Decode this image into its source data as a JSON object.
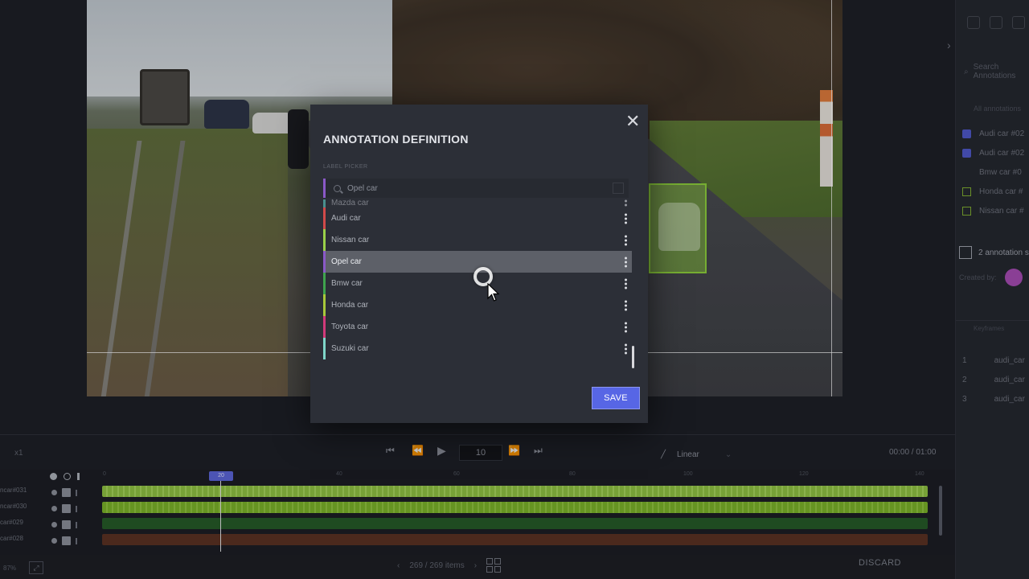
{
  "side_panel": {
    "search_placeholder": "Search Annotations",
    "heading": "All annotations",
    "items": [
      {
        "label": "Audi car #02",
        "kind": "checked"
      },
      {
        "label": "Audi car #02",
        "kind": "checked"
      },
      {
        "label": "Bmw car #0",
        "kind": "unchecked"
      },
      {
        "label": "Honda car #",
        "kind": "box"
      },
      {
        "label": "Nissan car #",
        "kind": "box"
      }
    ],
    "annotation_summary": "2 annotation s",
    "created_by": "Created by:",
    "sub_heading": "Keyframes",
    "keyframes": [
      {
        "index": "1",
        "label": "audi_car"
      },
      {
        "index": "2",
        "label": "audi_car"
      },
      {
        "index": "3",
        "label": "audi_car"
      }
    ]
  },
  "transport": {
    "speed": "x1",
    "frame": "10",
    "interpolation": "Linear",
    "timecode": "00:00 / 01:00"
  },
  "timeline": {
    "playhead": "20",
    "ticks": [
      "0",
      "40",
      "60",
      "80",
      "100",
      "120",
      "140"
    ],
    "rows": [
      {
        "label": "ncar#031",
        "bar": "bright",
        "fill": 1.0
      },
      {
        "label": "ncar#030",
        "bar": "bright",
        "fill": 1.0
      },
      {
        "label": "car#029",
        "bar": "dark",
        "fill": 1.0
      },
      {
        "label": "car#028",
        "bar": "red",
        "fill": 1.0
      }
    ]
  },
  "bottom": {
    "zoom": "87%",
    "pager": "269 / 269 items",
    "discard": "DISCARD"
  },
  "modal": {
    "title": "ANNOTATION DEFINITION",
    "picker_label": "LABEL PICKER",
    "search_value": "Opel car",
    "items": [
      {
        "label": "Mazda car",
        "color": "#5fd1c8",
        "state": "partial"
      },
      {
        "label": "Audi car",
        "color": "#d14a4a",
        "state": "normal"
      },
      {
        "label": "Nissan car",
        "color": "#9ad14a",
        "state": "normal"
      },
      {
        "label": "Opel car",
        "color": "#8a59c7",
        "state": "active"
      },
      {
        "label": "Bmw car",
        "color": "#3fa34d",
        "state": "normal"
      },
      {
        "label": "Honda car",
        "color": "#a8c93a",
        "state": "normal"
      },
      {
        "label": "Toyota car",
        "color": "#d13a7a",
        "state": "normal"
      },
      {
        "label": "Suzuki car",
        "color": "#7fd6c9",
        "state": "normal"
      }
    ],
    "save_label": "SAVE",
    "accent": "#5766e5"
  }
}
